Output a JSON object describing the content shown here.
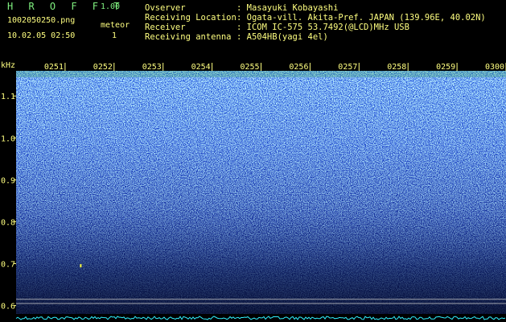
{
  "app": {
    "title": "H R O F F T",
    "version": "1.00"
  },
  "file_name": "1002050250.png",
  "meteor": {
    "label": "meteor",
    "count": "1"
  },
  "date_time": "10.02.05 02:50",
  "info": [
    {
      "key": "Ovserver",
      "value": ": Masayuki Kobayashi"
    },
    {
      "key": "Receiving Location",
      "value": ": Ogata-vill. Akita-Pref. JAPAN (139.96E, 40.02N)"
    },
    {
      "key": "Receiver",
      "value": ": ICOM IC-575 53.7492(@LCD)MHz USB"
    },
    {
      "key": "Receiving antenna",
      "value": ": A504HB(yagi 4el)"
    }
  ],
  "colors": {
    "label": "#ffff80",
    "title": "#7ff07f",
    "trace": "#30f0ff",
    "marker": "#ffff40"
  },
  "chart_data": {
    "type": "heatmap",
    "ylabel": "kHz",
    "x_ticks": [
      "0251",
      "0252",
      "0253",
      "0254",
      "0255",
      "0256",
      "0257",
      "0258",
      "0259",
      "0300"
    ],
    "y_ticks": [
      "1.1",
      "1.0",
      "0.9",
      "0.8",
      "0.7",
      "0.6"
    ],
    "y_tick_values": [
      1.1,
      1.0,
      0.9,
      0.8,
      0.7,
      0.6
    ],
    "ylim": [
      0.58,
      1.16
    ],
    "x_range_min": [
      0,
      10
    ],
    "reference_lines_khz": [
      0.605,
      0.615
    ],
    "meteor_events": [
      {
        "time_min": 1.32,
        "freq_khz": 0.695
      }
    ]
  }
}
